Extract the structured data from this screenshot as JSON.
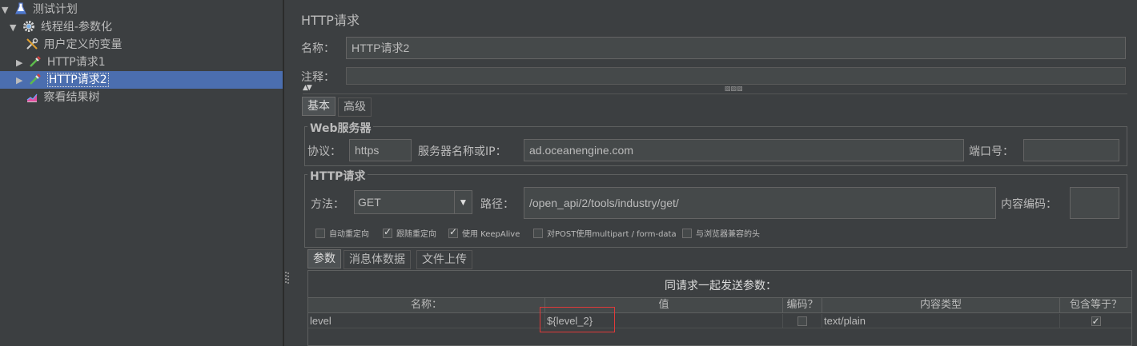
{
  "tree": {
    "items": [
      {
        "label": "测试计划",
        "icon": "flask-icon",
        "arrow": "▼"
      },
      {
        "label": "线程组-参数化",
        "icon": "gear-icon",
        "arrow": "▼"
      },
      {
        "label": "用户定义的变量",
        "icon": "wrench-icon",
        "arrow": ""
      },
      {
        "label": "HTTP请求1",
        "icon": "pipette-icon",
        "arrow": "▶"
      },
      {
        "label": "HTTP请求2",
        "icon": "pipette-icon",
        "arrow": "▶",
        "selected": true
      },
      {
        "label": "察看结果树",
        "icon": "chart-icon",
        "arrow": ""
      }
    ]
  },
  "panel": {
    "title": "HTTP请求",
    "name_label": "名称：",
    "name_value": "HTTP请求2",
    "comment_label": "注释：",
    "comment_value": "",
    "tabs": [
      "基本",
      "高级"
    ],
    "web_server": {
      "group_title": "Web服务器",
      "protocol_label": "协议：",
      "protocol_value": "https",
      "server_label": "服务器名称或IP：",
      "server_value": "ad.oceanengine.com",
      "port_label": "端口号：",
      "port_value": ""
    },
    "http_request": {
      "group_title": "HTTP请求",
      "method_label": "方法：",
      "method_value": "GET",
      "path_label": "路径：",
      "path_value": "/open_api/2/tools/industry/get/",
      "encoding_label": "内容编码：",
      "encoding_value": ""
    },
    "checkboxes": [
      {
        "label": "自动重定向",
        "checked": false
      },
      {
        "label": "跟随重定向",
        "checked": true
      },
      {
        "label": "使用 KeepAlive",
        "checked": true
      },
      {
        "label": "对POST使用multipart / form-data",
        "checked": false
      },
      {
        "label": "与浏览器兼容的头",
        "checked": false
      }
    ],
    "param_tabs": [
      "参数",
      "消息体数据",
      "文件上传"
    ],
    "params_caption": "同请求一起发送参数：",
    "columns": [
      "名称：",
      "值",
      "编码？",
      "内容类型",
      "包含等于？"
    ],
    "rows": [
      {
        "name": "level",
        "value": "${level_2}",
        "encode": false,
        "content_type": "text/plain",
        "include_equals": true
      }
    ],
    "highlight_color": "#e03a3a"
  }
}
